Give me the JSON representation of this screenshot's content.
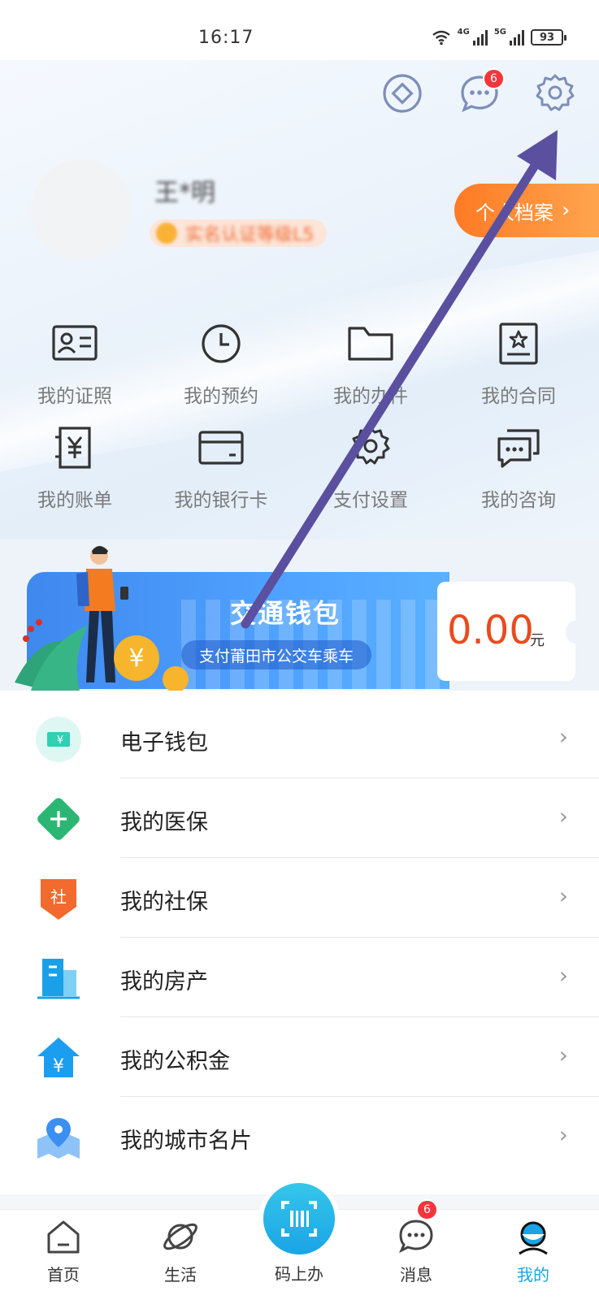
{
  "status_bar": {
    "time": "16:17",
    "net1": "4G",
    "net2": "5G",
    "battery": "93"
  },
  "header": {
    "message_badge": "6",
    "username": "王*明",
    "level_text": "实名认证等级L5",
    "profile_button": "个人档案"
  },
  "grid": [
    {
      "label": "我的证照",
      "icon": "id-card-icon"
    },
    {
      "label": "我的预约",
      "icon": "clock-icon"
    },
    {
      "label": "我的办件",
      "icon": "folder-icon"
    },
    {
      "label": "我的合同",
      "icon": "contract-icon"
    },
    {
      "label": "我的账单",
      "icon": "bill-icon"
    },
    {
      "label": "我的银行卡",
      "icon": "bank-card-icon"
    },
    {
      "label": "支付设置",
      "icon": "gear-icon"
    },
    {
      "label": "我的咨询",
      "icon": "chat-icon"
    }
  ],
  "wallet": {
    "title": "交通钱包",
    "subtitle": "支付莆田市公交车乘车",
    "amount": "0.00",
    "unit": "元"
  },
  "list": [
    {
      "label": "电子钱包",
      "icon": "e-wallet-icon",
      "color": "#2fd0b4"
    },
    {
      "label": "我的医保",
      "icon": "medical-insurance-icon",
      "color": "#2bb673"
    },
    {
      "label": "我的社保",
      "icon": "social-security-icon",
      "color": "#f26a2e"
    },
    {
      "label": "我的房产",
      "icon": "building-icon",
      "color": "#1aa0e8"
    },
    {
      "label": "我的公积金",
      "icon": "housing-fund-icon",
      "color": "#1c9ef0"
    },
    {
      "label": "我的城市名片",
      "icon": "location-pin-icon",
      "color": "#3a8ff0"
    }
  ],
  "list_chevron": "›",
  "bottom_nav": {
    "home": "首页",
    "life": "生活",
    "center": "码上办",
    "messages": "消息",
    "messages_badge": "6",
    "mine": "我的",
    "active_color": "#1aa4e6"
  },
  "annotation_arrow_color": "#5b4fa0"
}
